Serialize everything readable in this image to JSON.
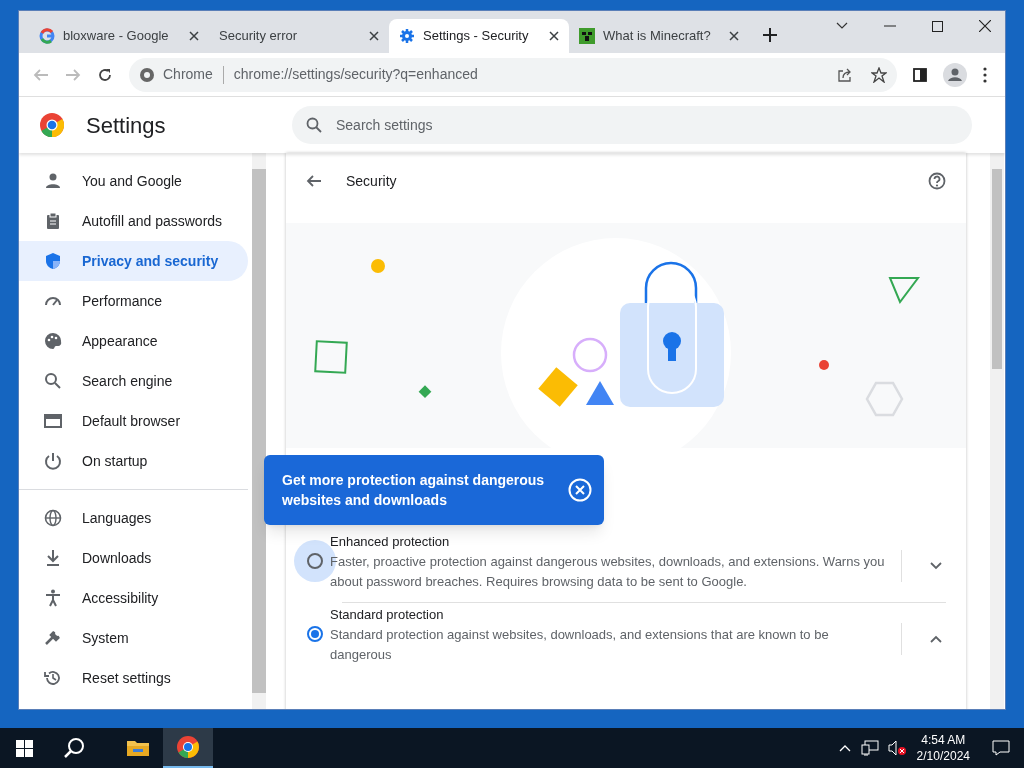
{
  "tabs": [
    {
      "title": "bloxware - Google",
      "selected": false
    },
    {
      "title": "Security error",
      "selected": false
    },
    {
      "title": "Settings - Security",
      "selected": true
    },
    {
      "title": "What is Minecraft?",
      "selected": false
    }
  ],
  "address_bar": {
    "site": "Chrome",
    "url": "chrome://settings/security?q=enhanced"
  },
  "settings_header": {
    "title": "Settings",
    "search": {
      "placeholder": "Search settings"
    }
  },
  "sidebar": {
    "groups": [
      [
        {
          "label": "You and Google",
          "selected": false
        },
        {
          "label": "Autofill and passwords",
          "selected": false
        },
        {
          "label": "Privacy and security",
          "selected": true
        },
        {
          "label": "Performance",
          "selected": false
        },
        {
          "label": "Appearance",
          "selected": false
        },
        {
          "label": "Search engine",
          "selected": false
        },
        {
          "label": "Default browser",
          "selected": false
        },
        {
          "label": "On startup",
          "selected": false
        }
      ],
      [
        {
          "label": "Languages",
          "selected": false
        },
        {
          "label": "Downloads",
          "selected": false
        },
        {
          "label": "Accessibility",
          "selected": false
        },
        {
          "label": "System",
          "selected": false
        },
        {
          "label": "Reset settings",
          "selected": false
        }
      ]
    ]
  },
  "page": {
    "title": "Security",
    "tooltip": "Get more protection against dangerous websites and downloads",
    "options": [
      {
        "title": "Enhanced protection",
        "description": "Faster, proactive protection against dangerous websites, downloads, and extensions. Warns you about password breaches. Requires browsing data to be sent to Google.",
        "selected": false,
        "focused": true,
        "expanded": false
      },
      {
        "title": "Standard protection",
        "description": "Standard protection against websites, downloads, and extensions that are known to be dangerous",
        "selected": true,
        "focused": false,
        "expanded": true
      }
    ]
  },
  "taskbar": {
    "apps": [
      {
        "active": false
      },
      {
        "active": true
      }
    ],
    "time": "4:54 AM",
    "date": "2/10/2024"
  }
}
